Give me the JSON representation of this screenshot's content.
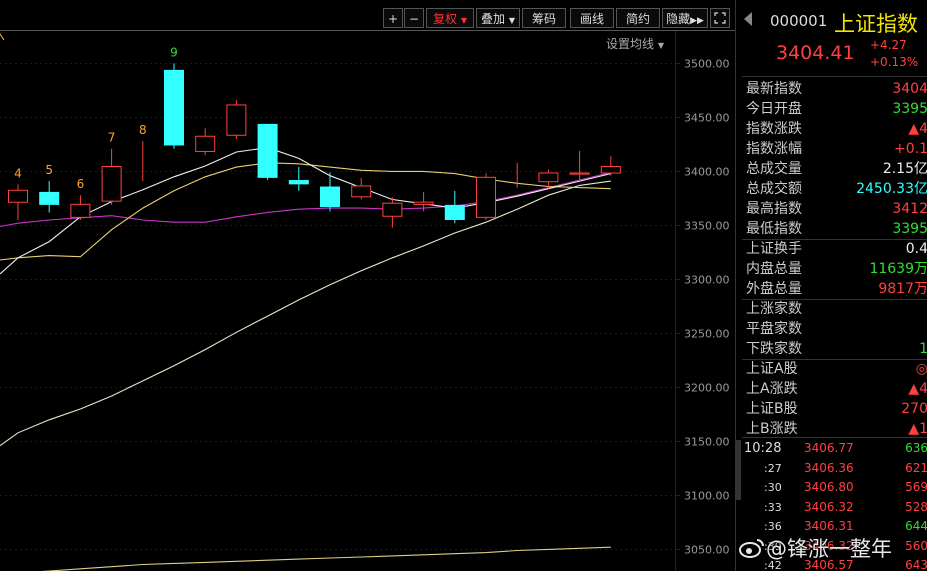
{
  "toolbar": {
    "plus": "+",
    "minus": "−",
    "fuquan": "复权",
    "diejia": "叠加",
    "chouma": "筹码",
    "huaxian": "画线",
    "jianyue": "简约",
    "yincang": "隐藏",
    "fullscreen_icon": "fullscreen-icon"
  },
  "settings_ma": "设置均线",
  "colors": {
    "up": "#ff4040",
    "down": "#33ffff",
    "grid": "#5a0000",
    "ma_yellow": "#e8e8a0",
    "ma_purple": "#cc33cc"
  },
  "chart_data": {
    "type": "candlestick",
    "ylim": [
      3030,
      3530
    ],
    "yticks": [
      3050.0,
      3100.0,
      3150.0,
      3200.0,
      3250.0,
      3300.0,
      3350.0,
      3400.0,
      3450.0,
      3500.0
    ],
    "candles": [
      {
        "o": 3371,
        "c": 3383,
        "h": 3388,
        "l": 3355,
        "label": "4",
        "up": true
      },
      {
        "o": 3381,
        "c": 3369,
        "h": 3391,
        "l": 3362,
        "label": "5",
        "up": false
      },
      {
        "o": 3357,
        "c": 3370,
        "h": 3378,
        "l": 3355,
        "label": "6",
        "up": true
      },
      {
        "o": 3372,
        "c": 3405,
        "h": 3421,
        "l": 3369,
        "label": "7",
        "up": true
      },
      {
        "o": 3403,
        "c": 3403,
        "h": 3428,
        "l": 3391,
        "label": "8",
        "up": true
      },
      {
        "o": 3494,
        "c": 3424,
        "h": 3500,
        "l": 3421,
        "label": "9",
        "up": false
      },
      {
        "o": 3418,
        "c": 3433,
        "h": 3440,
        "l": 3415,
        "label": "",
        "up": true
      },
      {
        "o": 3433,
        "c": 3462,
        "h": 3466,
        "l": 3430,
        "label": "",
        "up": true
      },
      {
        "o": 3444,
        "c": 3394,
        "h": 3444,
        "l": 3392,
        "label": "",
        "up": false
      },
      {
        "o": 3392,
        "c": 3388,
        "h": 3404,
        "l": 3382,
        "label": "",
        "up": false
      },
      {
        "o": 3386,
        "c": 3367,
        "h": 3399,
        "l": 3363,
        "label": "",
        "up": false
      },
      {
        "o": 3376,
        "c": 3387,
        "h": 3394,
        "l": 3374,
        "label": "",
        "up": true
      },
      {
        "o": 3358,
        "c": 3371,
        "h": 3376,
        "l": 3348,
        "label": "",
        "up": true
      },
      {
        "o": 3369,
        "c": 3372,
        "h": 3381,
        "l": 3363,
        "label": "",
        "up": true
      },
      {
        "o": 3369,
        "c": 3355,
        "h": 3382,
        "l": 3352,
        "label": "",
        "up": false
      },
      {
        "o": 3357,
        "c": 3395,
        "h": 3398,
        "l": 3355,
        "label": "",
        "up": true
      },
      {
        "o": 3394,
        "c": 3394,
        "h": 3408,
        "l": 3385,
        "label": "",
        "up": true
      },
      {
        "o": 3390,
        "c": 3399,
        "h": 3402,
        "l": 3384,
        "label": "",
        "up": true
      },
      {
        "o": 3397,
        "c": 3399,
        "h": 3419,
        "l": 3391,
        "label": "",
        "up": true
      },
      {
        "o": 3398,
        "c": 3405,
        "h": 3414,
        "l": 3396,
        "label": "",
        "up": true
      }
    ],
    "ma_short": [
      3320,
      3335,
      3358,
      3372,
      3383,
      3395,
      3405,
      3418,
      3422,
      3412,
      3396,
      3385,
      3374,
      3370,
      3366,
      3371,
      3377,
      3384,
      3391,
      3398
    ],
    "ma_mid": [
      3320,
      3322,
      3321,
      3346,
      3366,
      3382,
      3395,
      3404,
      3408,
      3407,
      3404,
      3401,
      3400,
      3400,
      3398,
      3393,
      3389,
      3386,
      3385,
      3384
    ],
    "ma_purple": [
      3352,
      3355,
      3357,
      3359,
      3355,
      3353,
      3353,
      3358,
      3362,
      3365,
      3366,
      3366,
      3365,
      3366,
      3368,
      3372,
      3378,
      3385,
      3392,
      3399
    ],
    "ma_long": [
      3158,
      3170,
      3180,
      3192,
      3206,
      3220,
      3235,
      3251,
      3266,
      3281,
      3295,
      3308,
      3320,
      3331,
      3343,
      3353,
      3365,
      3378,
      3387,
      3391
    ],
    "ma_vlong": [
      3028,
      3030,
      3032,
      3034,
      3036,
      3037,
      3038,
      3039,
      3040,
      3041,
      3042,
      3043,
      3044,
      3045,
      3046,
      3047,
      3049,
      3050,
      3051,
      3052
    ]
  },
  "side": {
    "code": "000001",
    "name": "上证指数",
    "price": "3404.41",
    "change": "+4.27",
    "change_pct": "+0.13%",
    "rows": [
      {
        "label": "最新指数",
        "value": "3404",
        "cls": "red"
      },
      {
        "label": "今日开盘",
        "value": "3395",
        "cls": "green"
      },
      {
        "label": "指数涨跌",
        "value": "▲4",
        "cls": "red"
      },
      {
        "label": "指数涨幅",
        "value": "+0.1",
        "cls": "red"
      },
      {
        "label": "总成交量",
        "value": "2.15亿",
        "cls": "white"
      },
      {
        "label": "总成交额",
        "value": "2450.33亿",
        "cls": "cyan"
      },
      {
        "label": "最高指数",
        "value": "3412",
        "cls": "red"
      },
      {
        "label": "最低指数",
        "value": "3395",
        "cls": "green"
      },
      {
        "label": "上证换手",
        "value": "0.4",
        "cls": "white"
      },
      {
        "label": "内盘总量",
        "value": "11639万",
        "cls": "green"
      },
      {
        "label": "外盘总量",
        "value": "9817万",
        "cls": "red"
      },
      {
        "label": "上涨家数",
        "value": "",
        "cls": "red"
      },
      {
        "label": "平盘家数",
        "value": "",
        "cls": "white"
      },
      {
        "label": "下跌家数",
        "value": "1",
        "cls": "green"
      },
      {
        "label": "上证A股",
        "value": "◎",
        "cls": "red"
      },
      {
        "label": "上A涨跌",
        "value": "▲4",
        "cls": "red"
      },
      {
        "label": "上证B股",
        "value": "270",
        "cls": "red"
      },
      {
        "label": "上B涨跌",
        "value": "▲1",
        "cls": "red"
      }
    ],
    "ticks": [
      {
        "time": "10:28",
        "price": "3406.77",
        "vol": "636",
        "cls": "green"
      },
      {
        "time": ":27",
        "price": "3406.36",
        "vol": "621",
        "cls": "red"
      },
      {
        "time": ":30",
        "price": "3406.80",
        "vol": "569",
        "cls": "red"
      },
      {
        "time": ":33",
        "price": "3406.32",
        "vol": "528",
        "cls": "red"
      },
      {
        "time": ":36",
        "price": "3406.31",
        "vol": "644",
        "cls": "green"
      },
      {
        "time": ":39",
        "price": "3406.32",
        "vol": "560",
        "cls": "red"
      },
      {
        "time": ":42",
        "price": "3406.57",
        "vol": "643",
        "cls": "red"
      }
    ]
  },
  "watermark": "@锋涨一整年"
}
